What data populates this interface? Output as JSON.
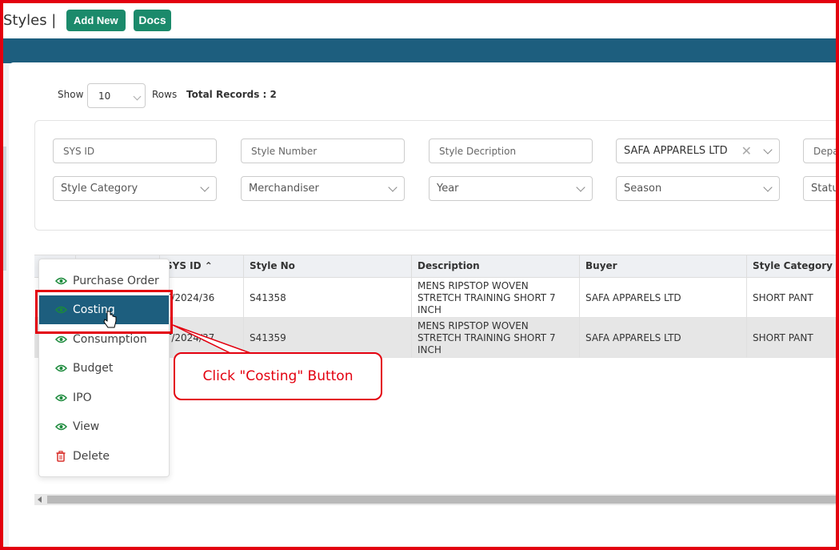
{
  "header": {
    "title": "Styles |",
    "add_new": "Add New",
    "docs": "Docs"
  },
  "controls": {
    "show": "Show",
    "rows_value": "10",
    "rows": "Rows",
    "total_records": "Total Records : 2"
  },
  "filters": {
    "sys_id": "SYS ID",
    "style_number": "Style Number",
    "style_description": "Style Decription",
    "buyer_value": "SAFA APPARELS LTD",
    "department": "Depa",
    "style_category": "Style Category",
    "merchandiser": "Merchandiser",
    "year": "Year",
    "season": "Season",
    "status": "Statu"
  },
  "table": {
    "headers": {
      "sys_id": "SYS ID",
      "style_no": "Style No",
      "description": "Description",
      "buyer": "Buyer",
      "style_category": "Style Category"
    },
    "rows": [
      {
        "sys_id": "T/2024/36",
        "style_no": "S41358",
        "description": "MENS RIPSTOP WOVEN STRETCH TRAINING SHORT 7 INCH",
        "buyer": "SAFA APPARELS LTD",
        "style_category": "SHORT PANT"
      },
      {
        "sys_id": "T/2024/37",
        "style_no": "S41359",
        "description": "MENS RIPSTOP WOVEN STRETCH TRAINING SHORT 7 INCH",
        "buyer": "SAFA APPARELS LTD",
        "style_category": "SHORT PANT"
      }
    ]
  },
  "menu": {
    "items": [
      {
        "label": "Purchase Order",
        "icon": "eye-icon"
      },
      {
        "label": "Costing",
        "icon": "eye-icon"
      },
      {
        "label": "Consumption",
        "icon": "eye-icon"
      },
      {
        "label": "Budget",
        "icon": "eye-icon"
      },
      {
        "label": "IPO",
        "icon": "eye-icon"
      },
      {
        "label": "View",
        "icon": "eye-icon"
      },
      {
        "label": "Delete",
        "icon": "trash-icon"
      }
    ]
  },
  "callout": {
    "text": "Click \"Costing\" Button"
  },
  "colors": {
    "brand_green": "#1b8a6b",
    "header_blue": "#1d5e7e",
    "annotation_red": "#e3000f",
    "eye_green": "#1b8a3b",
    "delete_red": "#d9302c"
  }
}
